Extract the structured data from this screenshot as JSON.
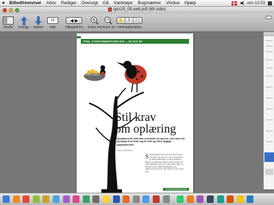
{
  "menubar": {
    "app_name": "Billedfremviser",
    "items": [
      "Arkiv",
      "Rediger",
      "Oversigt",
      "Gå",
      "Værktøjer",
      "Bogmærker",
      "Vindue",
      "Hjælp"
    ],
    "clock": "ons 10:53"
  },
  "window": {
    "title": "sprs18_08.web.pdf (68 sider)"
  },
  "toolbar": {
    "items": [
      {
        "label": "Skuffe"
      },
      {
        "label": "Forrige"
      },
      {
        "label": "Næste"
      },
      {
        "label": "Side",
        "value": "16"
      },
      {
        "label": "Tilbage/frem"
      },
      {
        "label": "Zoom ind"
      },
      {
        "label": "Zoom ud"
      },
      {
        "label": "Værktøjsfunktion"
      }
    ]
  },
  "page": {
    "header": "TEMA: SYGEHJEMMESYGEPLEJE — DE NYE ÅR",
    "headline_line1": "Stil krav",
    "headline_line2": "om oplæring",
    "lede": "Nyuddannede skal ikke overlades til sig selv, men have tid og hjælp til at finde sig til rette og blive dygtige sygeplejersker.",
    "byline": "Tekst og illustration",
    "body_dropcap": "S",
    "body_text": "ygeplejersker skal have tid til at lære faget ordentligt. Det kræver en plan for oplæring, en fast kontaktperson og tid til refleksion. Mange nyuddannede oplever at blive kastet ud i travle afdelinger uden den nødvendige støtte, og det går ud over både arbeidsglæden og patienterne. Derfor bør alle stille krav om en god start.",
    "footer": "SYGEPLEJERSKEN 18.2008"
  },
  "colors": {
    "accent": "#2e7d32",
    "dock_icons": [
      "#3b7bd4",
      "#f08a24",
      "#e04a3a",
      "#8bbf3c",
      "#c9a227",
      "#4fa3d8",
      "#a05fc8",
      "#d94a8a",
      "#3a9f6a",
      "#6c6c6c",
      "#ffd23a",
      "#2a56b0",
      "#e26b2b",
      "#8a8a8a",
      "#4c9be8",
      "#c0392b",
      "#7f8c8d",
      "#2ecc71",
      "#e67e22",
      "#9b59b6",
      "#34495e",
      "#16a085",
      "#d35400",
      "#f1c40f",
      "#2980b9"
    ]
  },
  "icons": {
    "drawer": "drawer-icon",
    "prev": "arrow-up-icon",
    "next": "arrow-down-icon",
    "back_forward": "back-forward-icon",
    "zoom_in": "zoom-in-icon",
    "zoom_out": "zoom-out-icon",
    "tool_mode": "tool-mode-icon"
  }
}
